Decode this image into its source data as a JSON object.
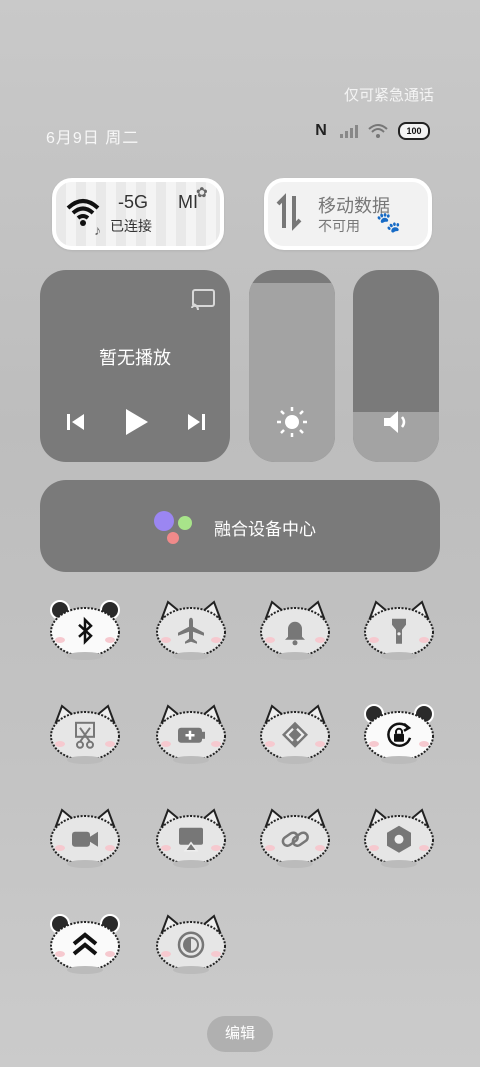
{
  "status_bar": {
    "emergency_text": "仅可紧急通话",
    "date": "6月9日 周二",
    "battery": "100"
  },
  "wifi_tile": {
    "title": "-5G",
    "title_suffix": "MI",
    "status": "已连接",
    "icon": "wifi-icon"
  },
  "mobile_tile": {
    "title": "移动数据",
    "status": "不可用",
    "icon": "mobile-data-icon"
  },
  "media": {
    "title": "暂无播放",
    "controls": [
      "previous-icon",
      "play-icon",
      "next-icon"
    ]
  },
  "sliders": {
    "brightness_level": 0.93,
    "volume_level": 0.26
  },
  "fusion": {
    "label": "融合设备中心"
  },
  "toggles": [
    {
      "id": "bluetooth",
      "icon": "bluetooth-icon",
      "active": true
    },
    {
      "id": "airplane",
      "icon": "airplane-icon",
      "active": false
    },
    {
      "id": "bell",
      "icon": "bell-icon",
      "active": false
    },
    {
      "id": "flashlight",
      "icon": "flashlight-icon",
      "active": false
    },
    {
      "id": "screenshot",
      "icon": "scissors-icon",
      "active": false
    },
    {
      "id": "battery-saver",
      "icon": "battery-plus-icon",
      "active": false
    },
    {
      "id": "nearby-share",
      "icon": "share-arrows-icon",
      "active": false
    },
    {
      "id": "rotation-lock",
      "icon": "rotation-lock-icon",
      "active": true
    },
    {
      "id": "screen-record",
      "icon": "video-camera-icon",
      "active": false
    },
    {
      "id": "screen-cast",
      "icon": "cast-screen-icon",
      "active": false
    },
    {
      "id": "link",
      "icon": "link-icon",
      "active": false
    },
    {
      "id": "settings",
      "icon": "hexagon-settings-icon",
      "active": false
    },
    {
      "id": "performance",
      "icon": "double-chevron-up-icon",
      "active": true
    },
    {
      "id": "dark-mode",
      "icon": "contrast-icon",
      "active": false
    }
  ],
  "edit_button": "编辑"
}
